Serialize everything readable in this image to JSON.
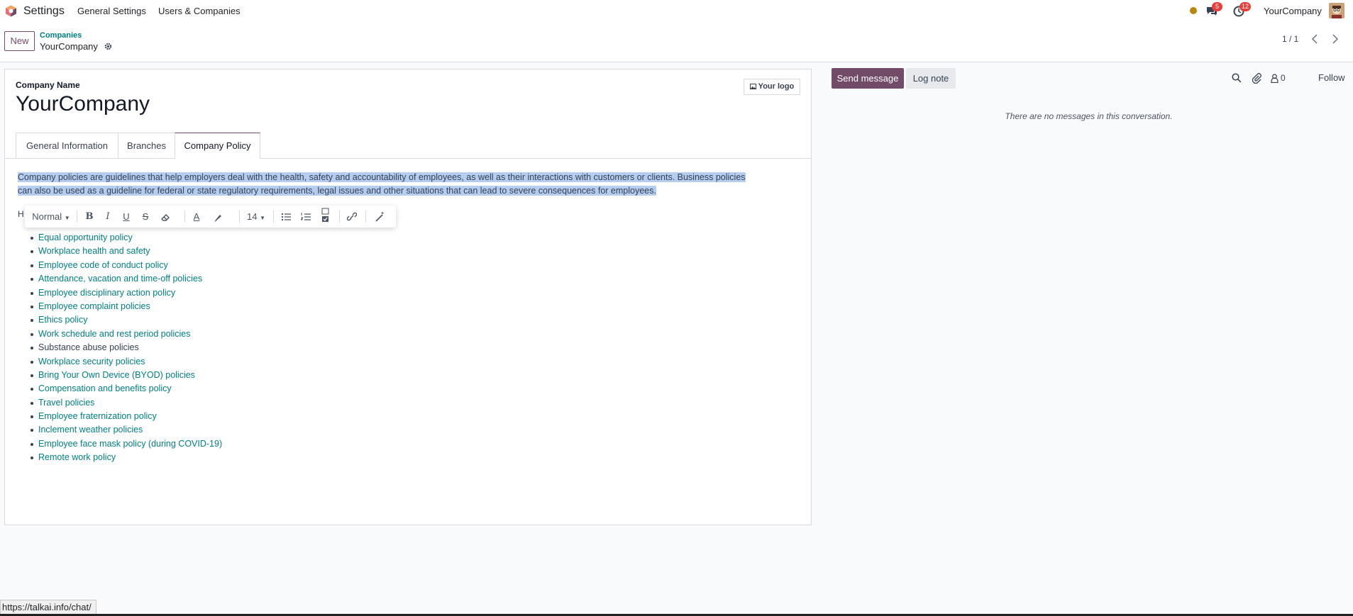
{
  "navbar": {
    "app_name": "Settings",
    "menu": [
      "General Settings",
      "Users & Companies"
    ],
    "messages_count": "5",
    "activities_count": "12",
    "company": "YourCompany"
  },
  "control_panel": {
    "new_label": "New",
    "breadcrumb_parent": "Companies",
    "breadcrumb_current": "YourCompany",
    "pager": "1 / 1"
  },
  "form": {
    "field_label": "Company Name",
    "company_name": "YourCompany",
    "logo_label": "Your logo",
    "tabs": [
      "General Information",
      "Branches",
      "Company Policy"
    ],
    "active_tab": "Company Policy",
    "intro_line1": "Company policies are guidelines that help employers deal with the health, safety and accountability of employees, as well as their interactions with customers or clients. Business policies",
    "intro_line2": "can also be used as a guideline for federal or state regulatory requirements, legal issues and other situations that can lead to severe consequences for employees.",
    "hidden_heading_char": "H",
    "policies": [
      "Equal opportunity policy",
      "Workplace health and safety",
      "Employee code of conduct policy",
      "Attendance, vacation and time-off policies",
      "Employee disciplinary action policy",
      "Employee complaint policies",
      "Ethics policy",
      "Work schedule and rest period policies",
      "Substance abuse policies",
      "Workplace security policies",
      "Bring Your Own Device (BYOD) policies",
      "Compensation and benefits policy",
      "Travel policies",
      "Employee fraternization policy",
      "Inclement weather policies",
      "Employee face mask policy (during COVID-19)",
      "Remote work policy"
    ]
  },
  "editor_toolbar": {
    "style_value": "Normal",
    "font_size_value": "14"
  },
  "chatter": {
    "send_message": "Send message",
    "log_note": "Log note",
    "followers_count": "0",
    "follow": "Follow",
    "empty_text": "There are no messages in this conversation."
  },
  "status_bar": {
    "url": "https://talkai.info/chat/"
  },
  "colors": {
    "brand": "#714b67",
    "link": "#017e84",
    "selection": "#b4cdf0",
    "badge": "#e5403a"
  }
}
